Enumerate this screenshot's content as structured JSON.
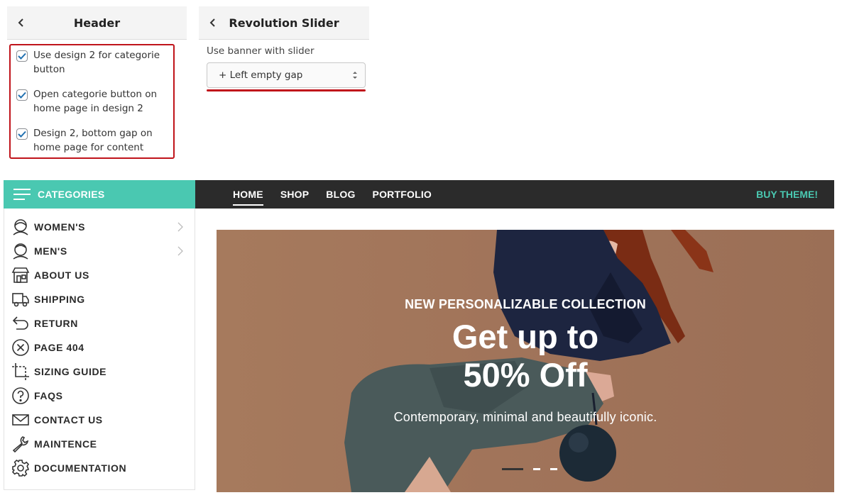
{
  "header_panel": {
    "title": "Header",
    "options": [
      {
        "label": "Use design 2 for categorie button",
        "checked": true
      },
      {
        "label": "Open categorie button on home page in design 2",
        "checked": true
      },
      {
        "label": "Design 2, bottom gap on home page for content",
        "checked": true
      }
    ]
  },
  "slider_panel": {
    "title": "Revolution Slider",
    "field_label": "Use banner with slider",
    "selected_option": "+ Left empty gap"
  },
  "navbar": {
    "categories_label": "CATEGORIES",
    "links": [
      "HOME",
      "SHOP",
      "BLOG",
      "PORTFOLIO"
    ],
    "active_link": "HOME",
    "buy_label": "BUY THEME!"
  },
  "categories": [
    {
      "label": "WOMEN'S",
      "icon": "woman-icon",
      "has_submenu": true
    },
    {
      "label": "MEN'S",
      "icon": "man-icon",
      "has_submenu": true
    },
    {
      "label": "ABOUT US",
      "icon": "store-icon",
      "has_submenu": false
    },
    {
      "label": "SHIPPING",
      "icon": "truck-icon",
      "has_submenu": false
    },
    {
      "label": "RETURN",
      "icon": "return-arrow-icon",
      "has_submenu": false
    },
    {
      "label": "PAGE 404",
      "icon": "x-circle-icon",
      "has_submenu": false
    },
    {
      "label": "SIZING GUIDE",
      "icon": "crop-icon",
      "has_submenu": false
    },
    {
      "label": "FAQS",
      "icon": "question-circle-icon",
      "has_submenu": false
    },
    {
      "label": "CONTACT US",
      "icon": "envelope-icon",
      "has_submenu": false
    },
    {
      "label": "MAINTENCE",
      "icon": "wrench-icon",
      "has_submenu": false
    },
    {
      "label": "DOCUMENTATION",
      "icon": "gear-icon",
      "has_submenu": false
    }
  ],
  "hero": {
    "kicker": "NEW PERSONALIZABLE COLLECTION",
    "title_line1": "Get up to",
    "title_line2": "50% Off",
    "subtitle": "Contemporary, minimal and beautifully iconic.",
    "slide_count": 3,
    "active_slide": 1
  },
  "colors": {
    "accent": "#4ac8b1",
    "nav_bg": "#2b2b2b",
    "highlight_red": "#c0141b",
    "hero_bg": "#a47659"
  }
}
